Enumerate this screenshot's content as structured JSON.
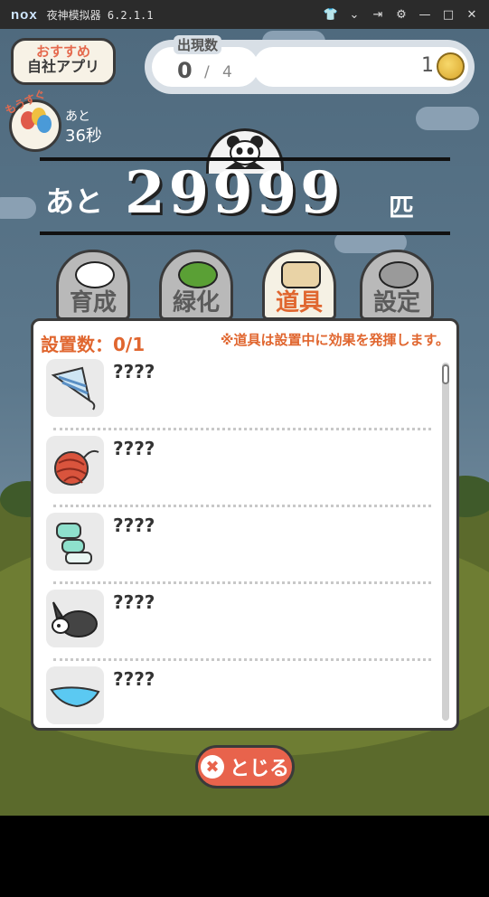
{
  "window": {
    "logo": "nox",
    "title": "夜神模拟器 6.2.1.1",
    "icons": [
      "shirt-icon",
      "chevron-down-icon",
      "pin-icon",
      "gear-icon",
      "minimize-icon",
      "maximize-icon",
      "close-icon"
    ]
  },
  "top": {
    "app_button": {
      "line1": "おすすめ",
      "line2": "自社アプリ"
    },
    "count": {
      "label": "出現数",
      "current": "0",
      "sep": "/",
      "total": "4"
    },
    "coins": "1"
  },
  "balloon": {
    "badge": "もうすぐ",
    "remain_label": "あと",
    "remain_value": "36秒"
  },
  "big_counter": {
    "prefix": "あと",
    "number": "29999",
    "unit": "匹"
  },
  "tabs": [
    {
      "label": "育成",
      "icon": "panda-icon",
      "active": false
    },
    {
      "label": "緑化",
      "icon": "tree-icon",
      "active": false
    },
    {
      "label": "道具",
      "icon": "basket-icon",
      "active": true
    },
    {
      "label": "設定",
      "icon": "gear-icon",
      "active": false
    }
  ],
  "panel": {
    "placed": "設置数：0/1",
    "note": "※道具は設置中に効果を発揮します。",
    "items": [
      {
        "name": "????",
        "icon": "party-horn-icon"
      },
      {
        "name": "????",
        "icon": "yarn-ball-icon"
      },
      {
        "name": "????",
        "icon": "towel-icon"
      },
      {
        "name": "????",
        "icon": "rabbit-icon"
      },
      {
        "name": "????",
        "icon": "underwear-icon"
      }
    ]
  },
  "close_button": {
    "label": "とじる"
  },
  "colors": {
    "accent": "#e0662f",
    "close": "#e8634c",
    "sky": "#4f6a7e"
  }
}
